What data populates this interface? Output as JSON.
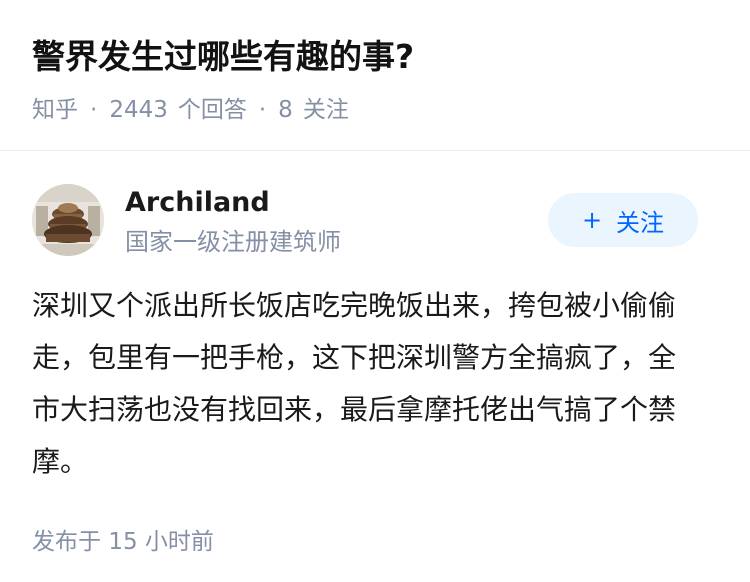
{
  "question": {
    "title": "警界发生过哪些有趣的事?",
    "source": "知乎",
    "answer_count": "2443",
    "answer_label": "个回答",
    "follow_count": "8",
    "follow_label": "关注",
    "separator": "·"
  },
  "answer": {
    "author_name": "Archiland",
    "author_headline": "国家一级注册建筑师",
    "follow_button_label": "关注",
    "follow_button_icon": "plus-icon",
    "content": "深圳又个派出所长饭店吃完晚饭出来，挎包被小偷偷走，包里有一把手枪，这下把深圳警方全搞疯了，全市大扫荡也没有找回来，最后拿摩托佬出气搞了个禁摩。",
    "published_prefix": "发布于",
    "published_time": "15 小时前"
  },
  "colors": {
    "meta_text": "#8590a6",
    "accent": "#0066ff",
    "follow_bg": "#ebf5fd"
  }
}
